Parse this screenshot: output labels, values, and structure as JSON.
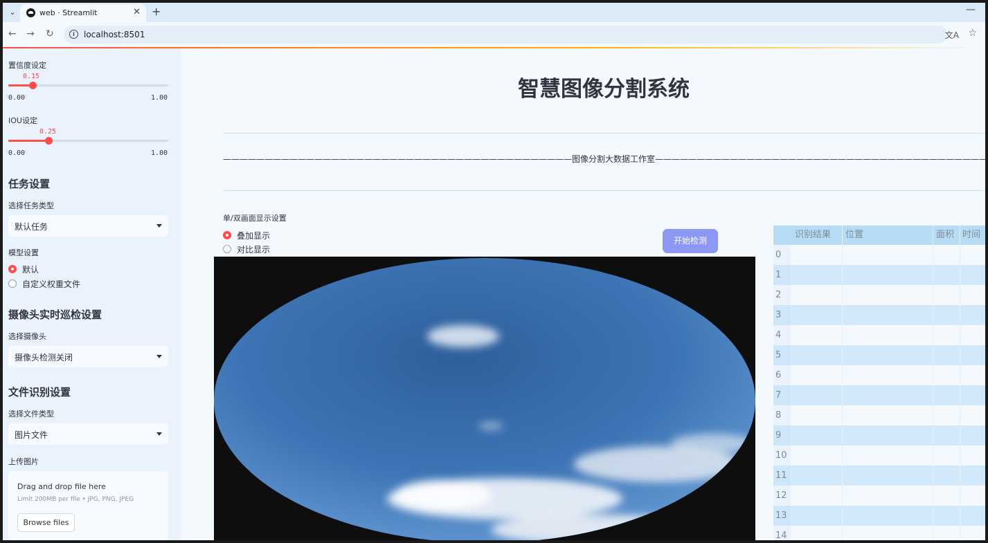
{
  "browser": {
    "tab_title": "web · Streamlit",
    "url": "localhost:8501"
  },
  "sidebar": {
    "confidence": {
      "label": "置信度设定",
      "value": "0.15",
      "min": "0.00",
      "max": "1.00",
      "fraction": 0.15
    },
    "iou": {
      "label": "IOU设定",
      "value": "0.25",
      "min": "0.00",
      "max": "1.00",
      "fraction": 0.25
    },
    "task": {
      "heading": "任务设置",
      "select_label": "选择任务类型",
      "selected": "默认任务"
    },
    "model": {
      "label": "模型设置",
      "options": [
        "默认",
        "自定义权重文件"
      ],
      "selected_index": 0
    },
    "camera": {
      "heading": "摄像头实时巡检设置",
      "select_label": "选择摄像头",
      "selected": "摄像头检测关闭"
    },
    "file": {
      "heading": "文件识别设置",
      "select_label": "选择文件类型",
      "selected": "图片文件"
    },
    "upload": {
      "label": "上传图片",
      "drop_text": "Drag and drop file here",
      "limit_text": "Limit 200MB per file • JPG, PNG, JPEG",
      "browse_label": "Browse files"
    }
  },
  "main": {
    "title": "智慧图像分割系统",
    "subtitle": "——————————————————————————————————————————图像分割大数据工作室——————————————————————————————————————————",
    "display_mode": {
      "label": "单/双画面显示设置",
      "options": [
        "叠加显示",
        "对比显示"
      ],
      "selected_index": 0
    },
    "start_button": "开始检测",
    "table": {
      "columns": [
        "识别结果",
        "位置",
        "面积",
        "时间"
      ],
      "row_indices": [
        "0",
        "1",
        "2",
        "3",
        "4",
        "5",
        "6",
        "7",
        "8",
        "9",
        "10",
        "11",
        "12",
        "13",
        "14"
      ]
    }
  },
  "colors": {
    "accent": "#ff4b4b",
    "button": "#8d97f4",
    "header": "#b7dcf5"
  }
}
